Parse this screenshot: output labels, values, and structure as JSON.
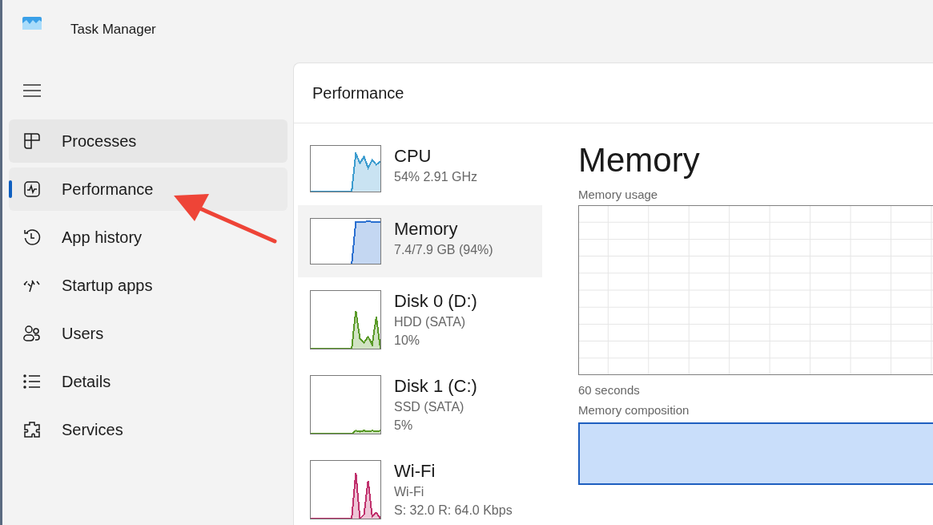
{
  "window": {
    "title": "Task Manager"
  },
  "sidebar": {
    "items": [
      {
        "label": "Processes",
        "kind": "processes",
        "selected": false,
        "hovered": true
      },
      {
        "label": "Performance",
        "kind": "performance",
        "selected": true,
        "hovered": false
      },
      {
        "label": "App history",
        "kind": "history",
        "selected": false,
        "hovered": false
      },
      {
        "label": "Startup apps",
        "kind": "startup",
        "selected": false,
        "hovered": false
      },
      {
        "label": "Users",
        "kind": "users",
        "selected": false,
        "hovered": false
      },
      {
        "label": "Details",
        "kind": "details",
        "selected": false,
        "hovered": false
      },
      {
        "label": "Services",
        "kind": "services",
        "selected": false,
        "hovered": false
      }
    ]
  },
  "page": {
    "title": "Performance"
  },
  "devices": [
    {
      "name": "CPU",
      "details": [
        "54%  2.91 GHz"
      ],
      "color": "#3c9ccf",
      "selected": false
    },
    {
      "name": "Memory",
      "details": [
        "7.4/7.9 GB (94%)"
      ],
      "color": "#2a6fd0",
      "selected": true
    },
    {
      "name": "Disk 0 (D:)",
      "details": [
        "HDD (SATA)",
        "10%"
      ],
      "color": "#5a9a28",
      "selected": false
    },
    {
      "name": "Disk 1 (C:)",
      "details": [
        "SSD (SATA)",
        "5%"
      ],
      "color": "#5a9a28",
      "selected": false
    },
    {
      "name": "Wi-Fi",
      "details": [
        "Wi-Fi",
        "S: 32.0 R: 64.0 Kbps"
      ],
      "color": "#c0306c",
      "selected": false
    }
  ],
  "detail": {
    "title": "Memory",
    "usage_label": "Memory usage",
    "time_label": "60 seconds",
    "composition_label": "Memory composition"
  }
}
